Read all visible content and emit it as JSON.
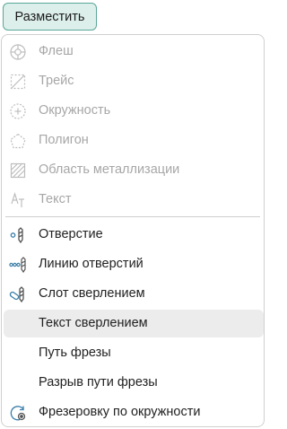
{
  "button": {
    "label": "Разместить"
  },
  "menu": {
    "group1": [
      {
        "label": "Флеш",
        "icon": "flash-icon"
      },
      {
        "label": "Трейс",
        "icon": "trace-icon"
      },
      {
        "label": "Окружность",
        "icon": "circle-icon"
      },
      {
        "label": "Полигон",
        "icon": "polygon-icon"
      },
      {
        "label": "Область металлизации",
        "icon": "copper-area-icon"
      },
      {
        "label": "Текст",
        "icon": "text-icon"
      }
    ],
    "group2": [
      {
        "label": "Отверстие",
        "icon": "hole-icon"
      },
      {
        "label": "Линию отверстий",
        "icon": "hole-line-icon"
      },
      {
        "label": "Слот сверлением",
        "icon": "drill-slot-icon"
      },
      {
        "label": "Текст сверлением",
        "icon": ""
      },
      {
        "label": "Путь фрезы",
        "icon": ""
      },
      {
        "label": "Разрыв пути фрезы",
        "icon": ""
      },
      {
        "label": "Фрезеровку по окружности",
        "icon": "circular-milling-icon"
      }
    ]
  },
  "colors": {
    "accent_border": "#5aa79a",
    "accent_fill": "#dcefeb",
    "highlight": "#ececec"
  }
}
